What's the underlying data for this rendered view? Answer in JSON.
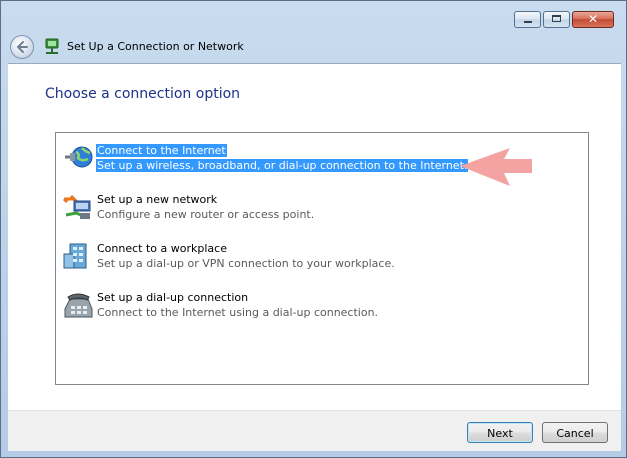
{
  "window": {
    "title": "Set Up a Connection or Network",
    "caption_buttons": {
      "minimize": "minimize-icon",
      "maximize": "maximize-icon",
      "close": "✕"
    }
  },
  "main": {
    "heading": "Choose a connection option",
    "options": [
      {
        "title": "Connect to the Internet",
        "description": "Set up a wireless, broadband, or dial-up connection to the Internet.",
        "icon": "globe-connect-icon",
        "selected": true
      },
      {
        "title": "Set up a new network",
        "description": "Configure a new router or access point.",
        "icon": "router-icon",
        "selected": false
      },
      {
        "title": "Connect to a workplace",
        "description": "Set up a dial-up or VPN connection to your workplace.",
        "icon": "workplace-building-icon",
        "selected": false
      },
      {
        "title": "Set up a dial-up connection",
        "description": "Connect to the Internet using a dial-up connection.",
        "icon": "dialup-phone-icon",
        "selected": false
      }
    ]
  },
  "buttons": {
    "next": "Next",
    "cancel": "Cancel"
  },
  "colors": {
    "selection": "#3399ff",
    "heading": "#1e3287",
    "pointer_arrow": "#f4a3a3"
  }
}
